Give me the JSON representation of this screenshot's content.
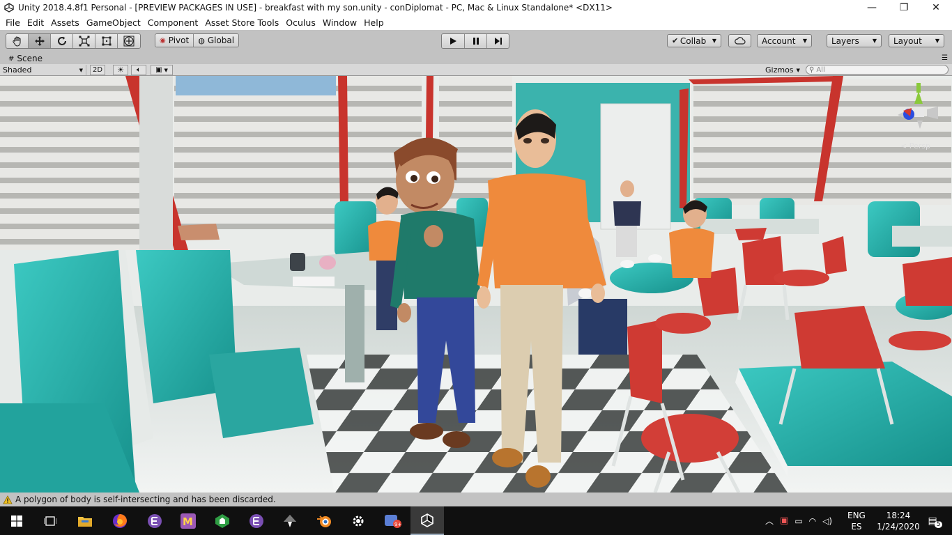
{
  "window": {
    "title": "Unity 2018.4.8f1 Personal - [PREVIEW PACKAGES IN USE] - breakfast with my son.unity - conDiplomat - PC, Mac & Linux Standalone* <DX11>",
    "minimize": "—",
    "maximize": "❐",
    "close": "✕"
  },
  "menubar": {
    "items": [
      "File",
      "Edit",
      "Assets",
      "GameObject",
      "Component",
      "Asset Store Tools",
      "Oculus",
      "Window",
      "Help"
    ]
  },
  "toolbar": {
    "tools": [
      "hand-tool-icon",
      "move-tool-icon",
      "rotate-tool-icon",
      "scale-tool-icon",
      "rect-tool-icon",
      "transform-tool-icon"
    ],
    "pivot_label": "Pivot",
    "global_label": "Global",
    "collab_label": "Collab",
    "account_label": "Account",
    "layers_label": "Layers",
    "layout_label": "Layout"
  },
  "scene": {
    "tab_label": "Scene",
    "shading_mode": "Shaded",
    "mode_2d": "2D",
    "gizmos_label": "Gizmos",
    "search_placeholder": "All",
    "persp_label": "< Persp"
  },
  "status": {
    "message": "A polygon of body is self-intersecting and has been discarded."
  },
  "taskbar": {
    "apps": [
      "windows-start-icon",
      "task-view-icon",
      "file-explorer-icon",
      "firefox-icon",
      "emacs-icon",
      "app-m-icon",
      "app-green-icon",
      "emacs-icon-2",
      "inkscape-icon",
      "blender-icon",
      "settings-icon",
      "app-badge-icon",
      "unity-icon"
    ],
    "language_top": "ENG",
    "language_bottom": "ES",
    "time": "18:24",
    "date": "1/24/2020",
    "notification_count": "5"
  },
  "colors": {
    "accent_red": "#cc3a33",
    "teal": "#2ab0aa",
    "editor_gray": "#c2c2c2",
    "taskbar": "#101010"
  }
}
